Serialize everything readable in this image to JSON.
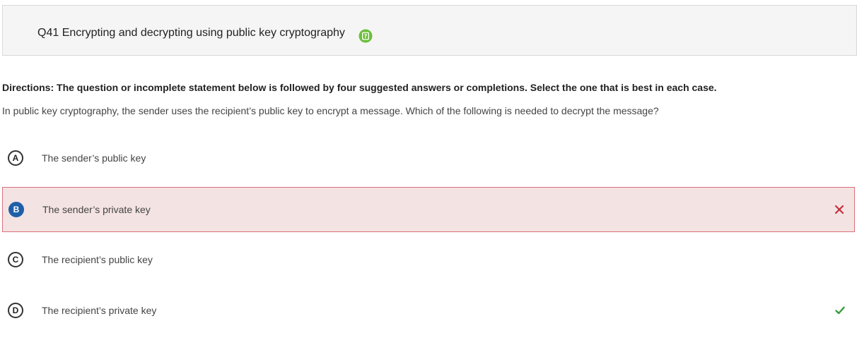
{
  "question": {
    "title": "Q41 Encrypting and decrypting using public key cryptography",
    "help_icon": "help-question-icon",
    "accent_color": "#6cbf3a"
  },
  "directions": "Directions: The question or incomplete statement below is followed by four suggested answers or completions. Select the one that is best in each case.",
  "stem": "In public key cryptography, the sender uses the recipient’s public key to encrypt a message. Which of the following is needed to decrypt the message?",
  "options": [
    {
      "letter": "A",
      "text": "The sender’s public key",
      "selected": false,
      "state": "neutral"
    },
    {
      "letter": "B",
      "text": "The sender’s private key",
      "selected": true,
      "state": "incorrect",
      "status_icon": "x-icon",
      "status_color": "#c62f3a"
    },
    {
      "letter": "C",
      "text": "The recipient’s public key",
      "selected": false,
      "state": "neutral"
    },
    {
      "letter": "D",
      "text": "The recipient’s private key",
      "selected": false,
      "state": "correct",
      "status_icon": "check-icon",
      "status_color": "#3a9a3f"
    }
  ],
  "colors": {
    "incorrect_bg": "#f4e3e3",
    "incorrect_border": "#d9707a",
    "selected_letter": "#1f5fa8"
  }
}
